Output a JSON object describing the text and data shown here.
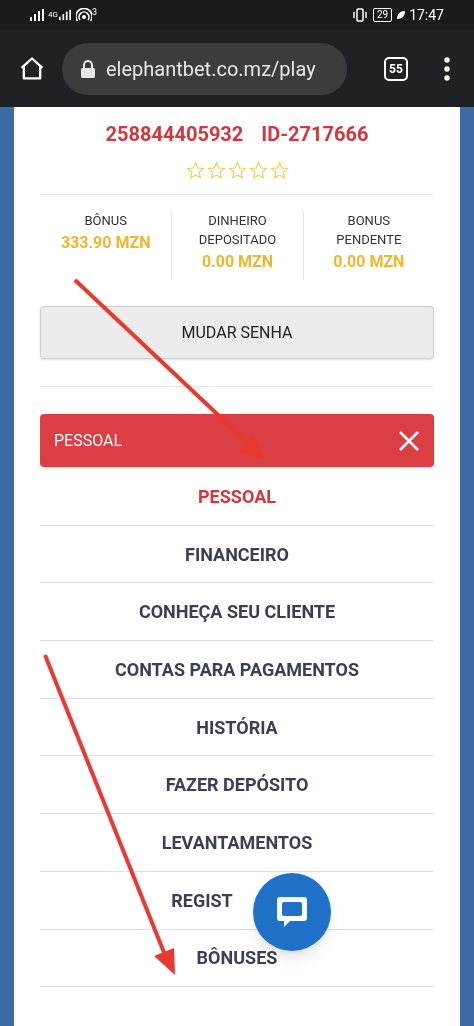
{
  "status_bar": {
    "network": "4G",
    "hotspot_count": "3",
    "battery": "29",
    "time": "17:47"
  },
  "browser": {
    "url": "elephantbet.co.mz/play",
    "tab_count": "55"
  },
  "profile": {
    "phone": "258844405932",
    "id": "ID-2717666",
    "stars": 0
  },
  "balances": [
    {
      "label": "BÔNUS",
      "value": "333.90 MZN"
    },
    {
      "label": "DINHEIRO DEPOSITADO",
      "value": "0.00 MZN"
    },
    {
      "label": "BONUS PENDENTE",
      "value": "0.00 MZN"
    }
  ],
  "change_password_button": "MUDAR SENHA",
  "section_header": {
    "title": "PESSOAL",
    "expanded": true
  },
  "menu": [
    {
      "label": "PESSOAL",
      "selected": true
    },
    {
      "label": "FINANCEIRO",
      "selected": false
    },
    {
      "label": "CONHEÇA SEU CLIENTE",
      "selected": false
    },
    {
      "label": "CONTAS PARA PAGAMENTOS",
      "selected": false
    },
    {
      "label": "HISTÓRIA",
      "selected": false
    },
    {
      "label": "FAZER DEPÓSITO",
      "selected": false
    },
    {
      "label": "LEVANTAMENTOS",
      "selected": false
    },
    {
      "label": "REGIST",
      "selected": false,
      "kind": "covered"
    },
    {
      "label": "BÔNUSES",
      "selected": false
    }
  ]
}
